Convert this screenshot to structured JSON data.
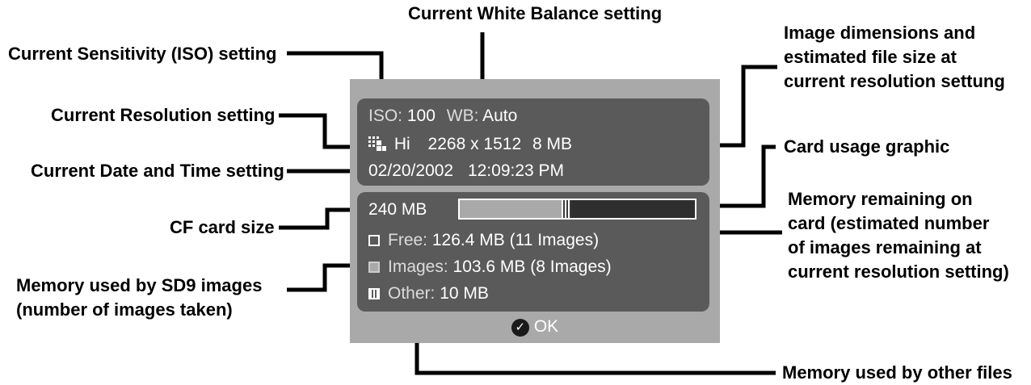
{
  "callouts": {
    "white_balance": "Current White Balance setting",
    "iso": "Current Sensitivity (ISO) setting",
    "resolution": "Current Resolution setting",
    "date_time": "Current Date and Time setting",
    "image_dims": [
      "Image dimensions and",
      "estimated file size at",
      "current resolution settung"
    ],
    "card_usage": "Card usage graphic",
    "cf_card_size": "CF card size",
    "memory_remaining": [
      "Memory remaining on",
      "card (estimated number",
      "of images remaining at",
      "current resolution setting)"
    ],
    "memory_sd9": [
      "Memory used by SD9 images",
      "(number of images taken)"
    ],
    "memory_other": "Memory used by other files"
  },
  "screen": {
    "iso_label": "ISO:",
    "iso_value": "100",
    "wb_label": "WB:",
    "wb_value": "Auto",
    "resolution_icon": "resolution-grid-icon",
    "resolution_value": "Hi",
    "dimensions": "2268 x 1512",
    "file_size": "8 MB",
    "date": "02/20/2002",
    "time": "12:09:23 PM",
    "card_size": "240 MB",
    "usage": {
      "images_mb": 103.6,
      "other_mb": 10,
      "free_mb": 126.4,
      "total_mb": 240
    },
    "free_label": "Free:",
    "free_value": "126.4 MB (11 Images)",
    "images_label": "Images:",
    "images_value": "103.6 MB (8 Images)",
    "other_label": "Other:",
    "other_value": "10 MB",
    "ok_label": "OK"
  },
  "colors": {
    "screen_bg": "#a9a9a9",
    "panel_bg": "#5a5a5a",
    "bar_free": "#2e2e2e"
  }
}
